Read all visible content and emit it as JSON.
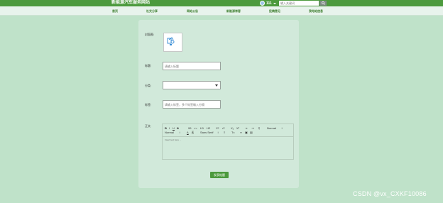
{
  "header": {
    "site_title": "新能源汽车服务网站",
    "username": "111",
    "search_placeholder": "输入关键词"
  },
  "nav": [
    {
      "label": "首页"
    },
    {
      "label": "社交分享"
    },
    {
      "label": "网站公告"
    },
    {
      "label": "新能源常客"
    },
    {
      "label": "投稿意见"
    },
    {
      "label": "我电站信息"
    }
  ],
  "form": {
    "cover_label": "封面图:",
    "title_label": "标题:",
    "title_placeholder": "请输入标题",
    "category_label": "分类:",
    "tags_label": "标签:",
    "tags_placeholder": "请输入标签，多个标签输入分隔",
    "content_label": "正文:",
    "editor_placeholder": "Insert text here ...",
    "submit_label": "发表帖题"
  },
  "editor_toolbar": {
    "bold": "B",
    "italic": "I",
    "underline": "U",
    "strike": "S",
    "quote": "99",
    "code": "<>",
    "h1": "H1",
    "h2": "H2",
    "ordered_list": "1≡",
    "bullet_list": "•≡",
    "subscript": "X₂",
    "superscript": "X²",
    "outdent": "⇤",
    "indent": "⇥",
    "direction": "¶",
    "size_top": "Normal",
    "size_bottom": "Normal",
    "font_family": "Sans Serif",
    "color": "A",
    "background": "A",
    "clean": "Tx"
  },
  "watermark": "CSDN @vx_CXKF10086"
}
